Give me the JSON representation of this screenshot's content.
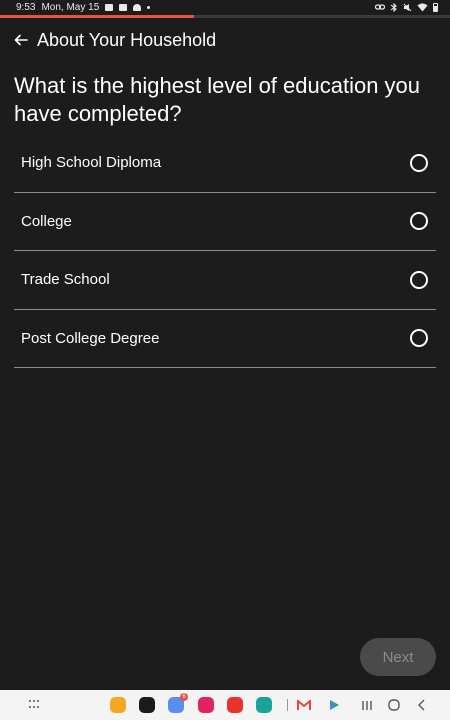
{
  "status_bar": {
    "time": "9:53",
    "date": "Mon, May 15"
  },
  "progress": {
    "fraction": 0.43,
    "color": "#e8533f"
  },
  "header": {
    "title": "About Your Household"
  },
  "question": {
    "text": "What is the highest level of education you have completed?"
  },
  "options": [
    {
      "label": "High School Diploma",
      "selected": false
    },
    {
      "label": "College",
      "selected": false
    },
    {
      "label": "Trade School",
      "selected": false
    },
    {
      "label": "Post College Degree",
      "selected": false
    }
  ],
  "next_button": {
    "label": "Next",
    "enabled": false
  },
  "dock": {
    "apps": [
      {
        "name": "notes-app-icon",
        "color": "#f5a623"
      },
      {
        "name": "black-app-icon",
        "color": "#1a1a1a"
      },
      {
        "name": "calendar-app-icon",
        "color": "#5b8def",
        "badge": "6"
      },
      {
        "name": "camera-app-icon",
        "color": "#e0245e"
      },
      {
        "name": "flipboard-app-icon",
        "color": "#e8332a"
      },
      {
        "name": "meet-app-icon",
        "color": "#1aa39a"
      },
      {
        "name": "gmail-app-icon",
        "color": "#ea4335"
      },
      {
        "name": "play-store-app-icon",
        "color": "#34a853"
      }
    ]
  },
  "colors": {
    "background": "#1c1c1c",
    "accent": "#e8533f",
    "divider": "#8a8a8a",
    "button_disabled": "#4a4a4a"
  }
}
